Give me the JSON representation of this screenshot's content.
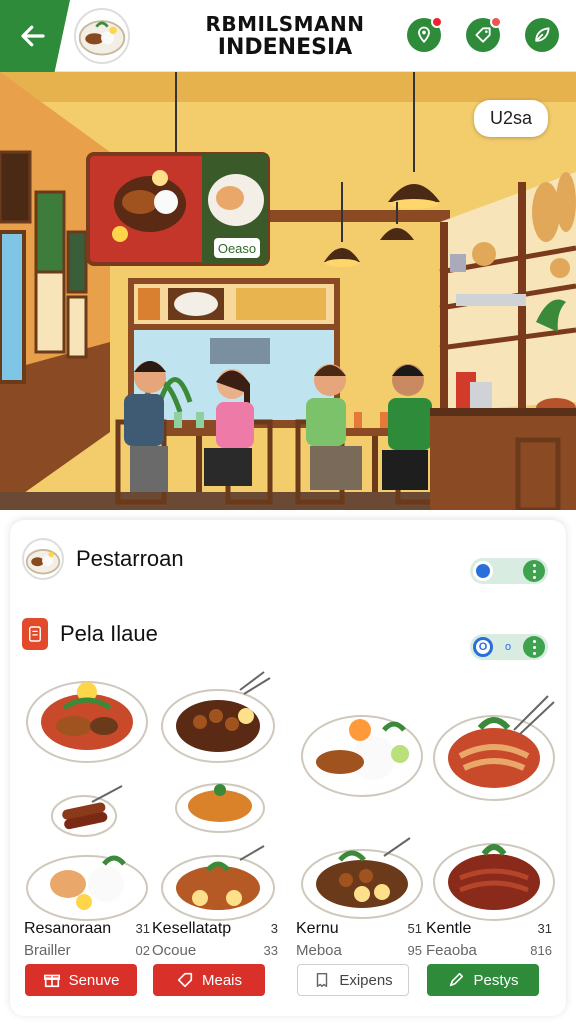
{
  "header": {
    "title_line1": "RBMILSMANN",
    "title_line2": "INDENESIA",
    "icons": [
      "back-arrow-icon",
      "dish-logo-icon",
      "location-pin-icon",
      "tag-icon",
      "leaf-icon"
    ]
  },
  "hero": {
    "pill_label": "U2sa",
    "menu_board_label": "Oeaso"
  },
  "panel": {
    "restaurant_label": "Pestarroan",
    "section_label": "Pela Ilaue",
    "toggle2_knob_text": "O",
    "toggle2_mid_text": "o",
    "items": [
      {
        "name": "Resanoraan",
        "num": "31",
        "sub": "Brailler",
        "num2": "02",
        "button": "Senuve",
        "button_style": "red",
        "button_icon": "gift-icon"
      },
      {
        "name": "Kesellatatp",
        "num": "3",
        "sub": "Ocoue",
        "num2": "33",
        "button": "Meais",
        "button_style": "red",
        "button_icon": "tag-icon"
      },
      {
        "name": "Kernu",
        "num": "51",
        "sub": "Meboa",
        "num2": "95",
        "button": "Exipens",
        "button_style": "white",
        "button_icon": "receipt-icon"
      },
      {
        "name": "Kentle",
        "num": "31",
        "sub": "Feaoba",
        "num2": "816",
        "button": "Pestys",
        "button_style": "green",
        "button_icon": "pen-icon"
      }
    ]
  },
  "colors": {
    "brand_green": "#2e8b3a",
    "accent_red": "#d9312a",
    "toggle_blue": "#2a6edb",
    "wall_yellow": "#f1c96a"
  }
}
